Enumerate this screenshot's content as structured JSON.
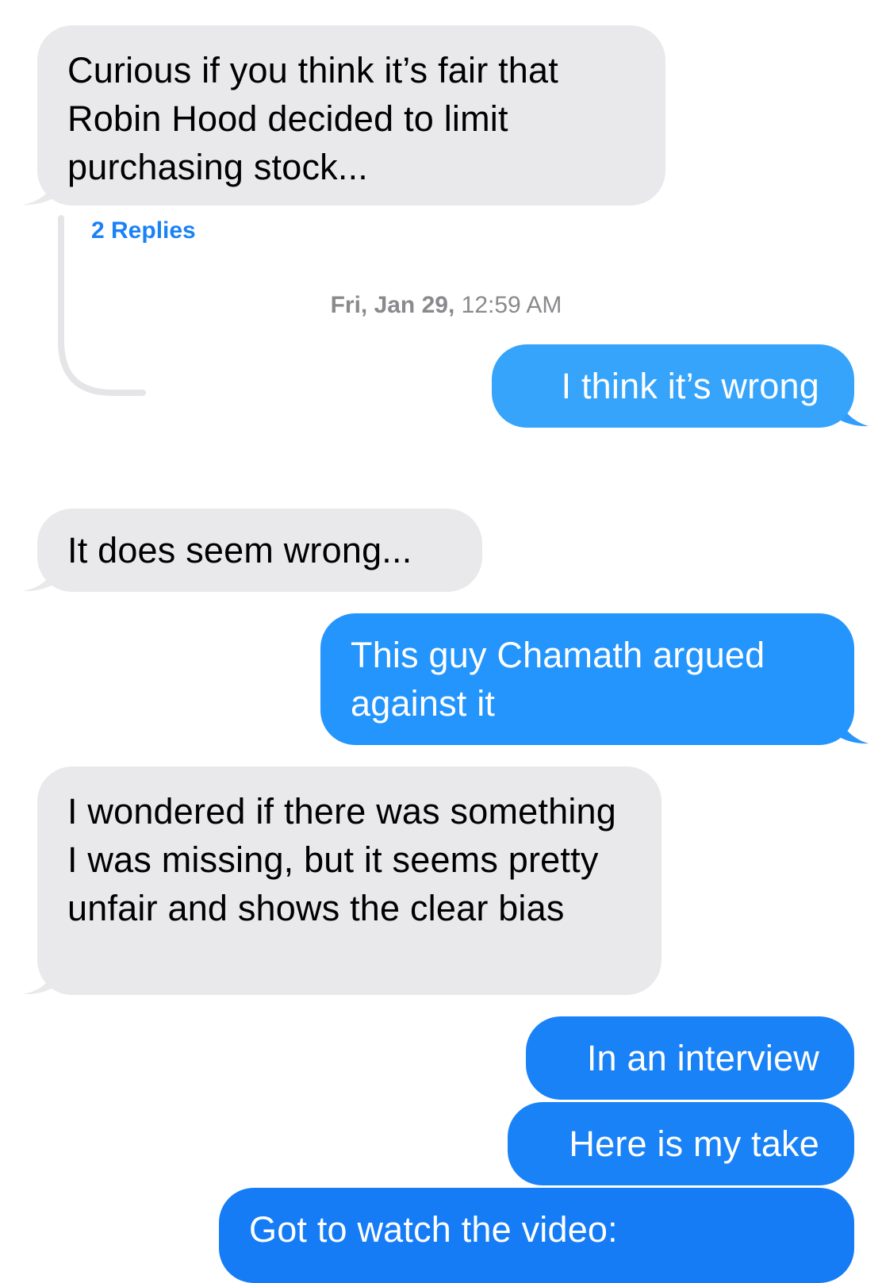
{
  "messages": [
    {
      "from": "them",
      "text": "Curious if you think it’s fair that Robin Hood decided to limit purchasing  stock..."
    },
    {
      "from": "me",
      "text": "I think it’s wrong"
    },
    {
      "from": "them",
      "text": "It does seem wrong..."
    },
    {
      "from": "me",
      "text": "This guy Chamath argued against it"
    },
    {
      "from": "them",
      "text": "I wondered if there was something I was missing, but it seems pretty unfair and shows the clear bias"
    },
    {
      "from": "me",
      "text": "In an interview"
    },
    {
      "from": "me",
      "text": "Here is my take"
    },
    {
      "from": "me",
      "text": "Got to watch the video:"
    }
  ],
  "thread": {
    "replies_label": "2 Replies"
  },
  "timestamp": {
    "day": "Fri, Jan 29,",
    "time": "12:59 AM"
  },
  "colors": {
    "incoming_bubble": "#e9e9eb",
    "outgoing_gradient": [
      "#36a4fb",
      "#2495fc",
      "#1a82f7",
      "#157cf6"
    ],
    "link_blue": "#1a82f7",
    "timestamp_gray": "#8a8a8e"
  }
}
